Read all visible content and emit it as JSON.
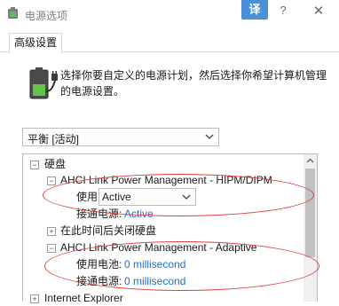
{
  "window": {
    "title": "电源选项",
    "translate_label": "译",
    "help_label": "?",
    "close_label": "✕"
  },
  "tab": {
    "label": "高级设置"
  },
  "description": "选择你要自定义的电源计划，然后选择你希望计算机管理的电源设置。",
  "plan": {
    "selected": "平衡 [活动]"
  },
  "tree": {
    "sections": [
      {
        "label": "硬盘",
        "expanded": true
      },
      {
        "label": "AHCI Link Power Management - HIPM/DIPM",
        "expanded": true
      },
      {
        "label": "在此时间后关闭硬盘",
        "expanded": false
      },
      {
        "label": "AHCI Link Power Management - Adaptive",
        "expanded": true
      },
      {
        "label": "Internet Explorer",
        "expanded": false
      }
    ],
    "hipm": {
      "battery_label": "使用电池:",
      "battery_value": "Active",
      "plugged_label": "接通电源:",
      "plugged_value": "Active"
    },
    "adaptive": {
      "battery_label": "使用电池:",
      "battery_value": "0 millisecond",
      "plugged_label": "接通电源:",
      "plugged_value": "0 millisecond"
    }
  },
  "icons": {
    "app": "power-options-icon",
    "battery": "battery-plug-icon",
    "dropdown": "chevron-down-icon",
    "collapse": "minus-box-icon",
    "expand": "plus-box-icon"
  },
  "colors": {
    "translate_button": "#4a90d9",
    "link": "#1e6fcf",
    "annotation": "#e04040"
  }
}
